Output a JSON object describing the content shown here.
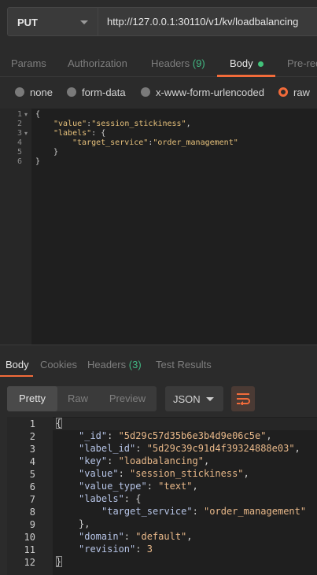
{
  "request": {
    "method": "PUT",
    "url": "http://127.0.0.1:30110/v1/kv/loadbalancing"
  },
  "request_tabs": [
    {
      "label": "Params"
    },
    {
      "label": "Authorization"
    },
    {
      "label": "Headers",
      "count": "(9)"
    },
    {
      "label": "Body"
    },
    {
      "label": "Pre-req"
    }
  ],
  "body_types": {
    "none": "none",
    "form_data": "form-data",
    "urlencoded": "x-www-form-urlencoded",
    "raw": "raw"
  },
  "request_body": {
    "line_numbers": [
      "1",
      "2",
      "3",
      "4",
      "5",
      "6"
    ],
    "l1": "{",
    "l2_key": "\"value\"",
    "l2_val": "\"session_stickiness\"",
    "l3_key": "\"labels\"",
    "l3_rest": ": {",
    "l4_key": "\"target_service\"",
    "l4_val": "\"order_management\"",
    "l5": "}",
    "l6": "}"
  },
  "response_tabs": [
    {
      "label": "Body"
    },
    {
      "label": "Cookies"
    },
    {
      "label": "Headers",
      "count": "(3)"
    },
    {
      "label": "Test Results"
    }
  ],
  "view_modes": {
    "pretty": "Pretty",
    "raw": "Raw",
    "preview": "Preview"
  },
  "format": "JSON",
  "response_body": {
    "line_numbers": [
      "1",
      "2",
      "3",
      "4",
      "5",
      "6",
      "7",
      "8",
      "9",
      "10",
      "11",
      "12"
    ],
    "open": "{",
    "id_key": "\"_id\"",
    "id_val": "\"5d29c57d35b6e3b4d9e06c5e\"",
    "label_id_key": "\"label_id\"",
    "label_id_val": "\"5d29c39c91d4f39324888e03\"",
    "key_key": "\"key\"",
    "key_val": "\"loadbalancing\"",
    "value_key": "\"value\"",
    "value_val": "\"session_stickiness\"",
    "value_type_key": "\"value_type\"",
    "value_type_val": "\"text\"",
    "labels_key": "\"labels\"",
    "target_key": "\"target_service\"",
    "target_val": "\"order_management\"",
    "labels_close": "},",
    "domain_key": "\"domain\"",
    "domain_val": "\"default\"",
    "revision_key": "\"revision\"",
    "revision_val": "3",
    "close": "}"
  }
}
